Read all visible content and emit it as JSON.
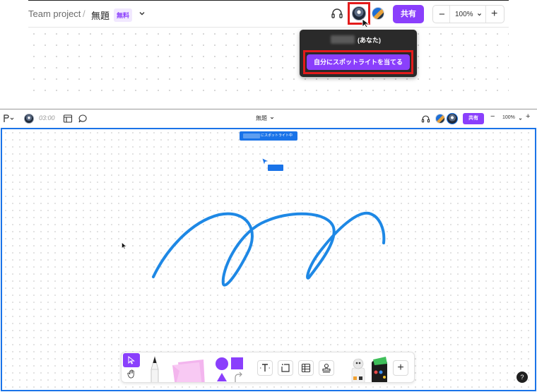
{
  "zoomed_header": {
    "team": "Team project",
    "separator": "/",
    "file_title": "無題",
    "plan_badge": "無料",
    "share_label": "共有",
    "zoom_label": "100%",
    "popup": {
      "you_label": "(あなた)",
      "spotlight_button": "自分にスポットライトを当てる"
    }
  },
  "app": {
    "timer": "03:00",
    "file_title": "無題",
    "share_label": "共有",
    "zoom_label": "100%",
    "spotlight_banner": "にスポットライト中",
    "help": "?"
  },
  "colors": {
    "accent": "#8a3ffc",
    "spotlight_blue": "#1a73e8",
    "stroke_blue": "#1e88e5",
    "highlight_red": "#e31b1b"
  },
  "icons": {
    "headset": "headset-icon",
    "chevron": "chevron-down-icon",
    "comment": "comment-icon",
    "layout": "layout-icon",
    "cursor": "cursor-icon",
    "hand": "hand-icon",
    "text": "text-icon",
    "frame": "frame-icon",
    "table": "table-icon",
    "stamp": "stamp-icon",
    "plus": "plus-icon"
  }
}
